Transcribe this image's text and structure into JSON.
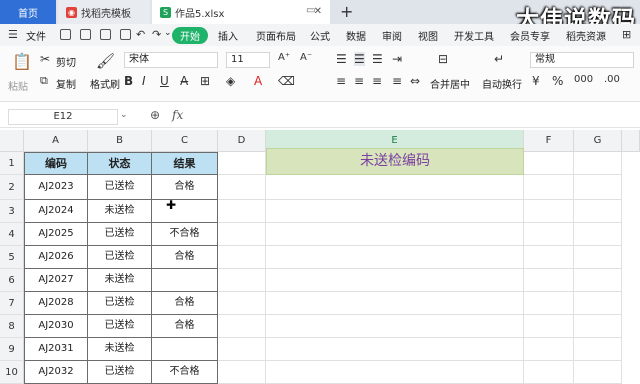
{
  "titlebar": {
    "home_tab": "首页",
    "tab2": "找稻壳模板",
    "tab3": "作品5.xlsx",
    "watermark": "大伟说数码"
  },
  "menubar": {
    "file": "文件",
    "items": [
      "开始",
      "插入",
      "页面布局",
      "公式",
      "数据",
      "审阅",
      "视图",
      "开发工具",
      "会员专享",
      "稻壳资源"
    ]
  },
  "ribbon": {
    "paste": "粘贴",
    "cut": "剪切",
    "copy": "复制",
    "format_painter": "格式刷",
    "font_name": "宋体",
    "font_size": "11",
    "merge_center": "合并居中",
    "wrap_text": "自动换行",
    "number_format": "常规"
  },
  "formula_bar": {
    "name_box": "E12",
    "fx": "fx",
    "value": ""
  },
  "grid": {
    "columns": [
      "A",
      "B",
      "C",
      "D",
      "E",
      "F",
      "G"
    ],
    "selected_column": "E",
    "rows": [
      "1",
      "2",
      "3",
      "4",
      "5",
      "6",
      "7",
      "8",
      "9",
      "10"
    ],
    "header": {
      "a": "编码",
      "b": "状态",
      "c": "结果"
    },
    "e1": "未送检编码",
    "data": [
      {
        "a": "AJ2023",
        "b": "已送检",
        "c": "合格"
      },
      {
        "a": "AJ2024",
        "b": "未送检",
        "c": ""
      },
      {
        "a": "AJ2025",
        "b": "已送检",
        "c": "不合格"
      },
      {
        "a": "AJ2026",
        "b": "已送检",
        "c": "合格"
      },
      {
        "a": "AJ2027",
        "b": "未送检",
        "c": ""
      },
      {
        "a": "AJ2028",
        "b": "已送检",
        "c": "合格"
      },
      {
        "a": "AJ2030",
        "b": "已送检",
        "c": "合格"
      },
      {
        "a": "AJ2031",
        "b": "未送检",
        "c": ""
      },
      {
        "a": "AJ2032",
        "b": "已送检",
        "c": "不合格"
      }
    ]
  }
}
